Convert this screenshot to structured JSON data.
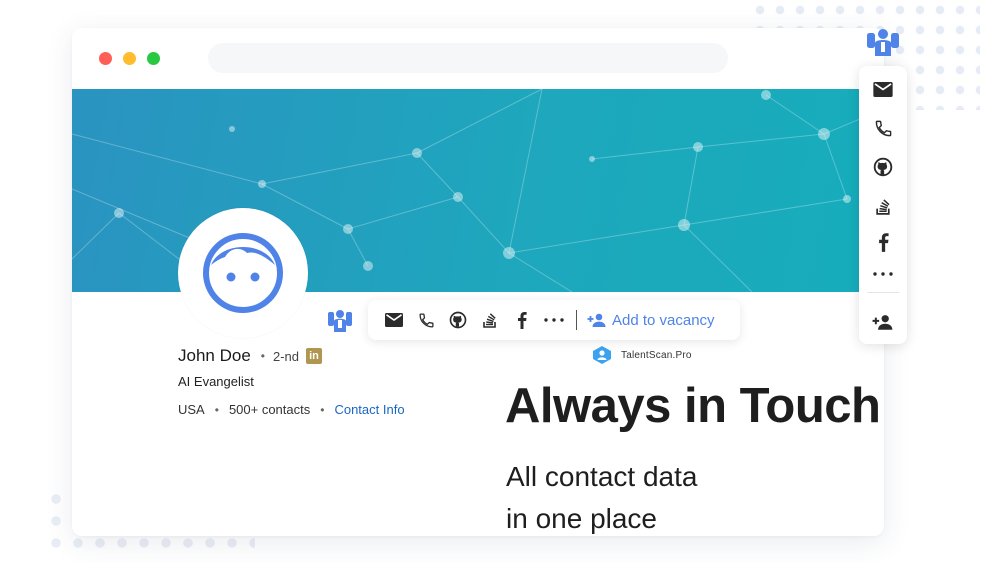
{
  "profile": {
    "name": "John Doe",
    "separator": "•",
    "degree": "2-nd",
    "linkedin_badge": "in",
    "headline": "AI Evangelist",
    "location": "USA",
    "connections": "500+ contacts",
    "contact_info": "Contact Info",
    "avatar_icon": "face-avatar-icon"
  },
  "toolbar": {
    "icons": [
      "email-icon",
      "phone-icon",
      "github-icon",
      "stackoverflow-icon",
      "facebook-icon",
      "more-icon"
    ],
    "add_to_vacancy": "Add to vacancy",
    "add_icon": "add-person-icon"
  },
  "brand": {
    "name": "TalentScan.Pro",
    "logo_icon": "talentscan-logo-icon"
  },
  "sidebar": {
    "icons": [
      "email-icon",
      "phone-icon",
      "github-icon",
      "stackoverflow-icon",
      "facebook-icon",
      "more-icon",
      "add-person-icon"
    ]
  },
  "promo": {
    "title": "Always in Touch",
    "subtitle_line1": "All contact data",
    "subtitle_line2": "in one place"
  },
  "colors": {
    "banner_start": "#2a93c0",
    "banner_end": "#16adbb",
    "accent_blue": "#4f83e8",
    "link_blue": "#1a66c2",
    "linkedin_badge": "#b09650"
  }
}
